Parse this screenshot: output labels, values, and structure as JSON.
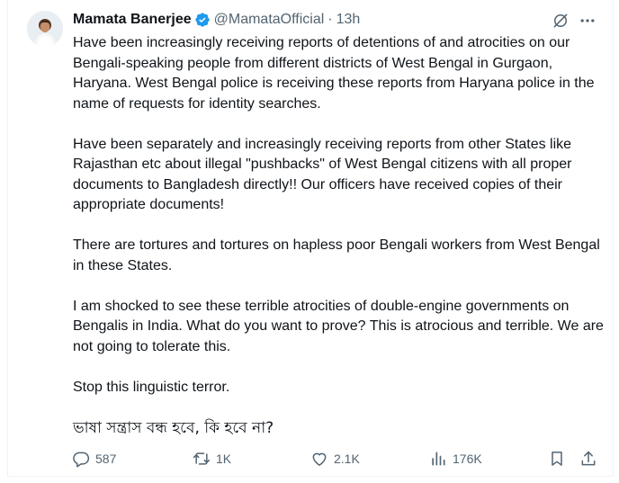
{
  "tweet": {
    "author_name": "Mamata Banerjee",
    "handle": "@MamataOfficial",
    "separator": "·",
    "time": "13h",
    "paragraphs": [
      "Have been increasingly receiving reports of detentions of and atrocities on our Bengali-speaking people from different districts of West Bengal in Gurgaon, Haryana. West Bengal police is receiving these reports from Haryana police in the name of requests for identity searches.",
      "Have been separately and increasingly receiving reports from other States like Rajasthan etc about illegal \"pushbacks\" of West Bengal citizens with all proper documents to Bangladesh directly!! Our officers have received copies of their appropriate documents!",
      "There are tortures and tortures on hapless poor Bengali workers from West Bengal in these States.",
      "I am shocked to see these terrible atrocities of double-engine governments on Bengalis in India. What do you want to prove? This is atrocious and terrible. We are not going to tolerate this.",
      "Stop this linguistic terror.",
      "ভাষা সন্ত্রাস বন্ধ হবে, কি হবে না?"
    ]
  },
  "actions": {
    "replies": "587",
    "reposts": "1K",
    "likes": "2.1K",
    "views": "176K"
  },
  "icons": {
    "verified": "verified-badge-icon",
    "grok": "grok-icon",
    "more": "more-icon",
    "reply": "reply-icon",
    "repost": "repost-icon",
    "like": "like-icon",
    "views": "views-icon",
    "bookmark": "bookmark-icon",
    "share": "share-icon"
  },
  "colors": {
    "text": "#0f1419",
    "secondary": "#536471",
    "verified": "#1d9bf0"
  }
}
